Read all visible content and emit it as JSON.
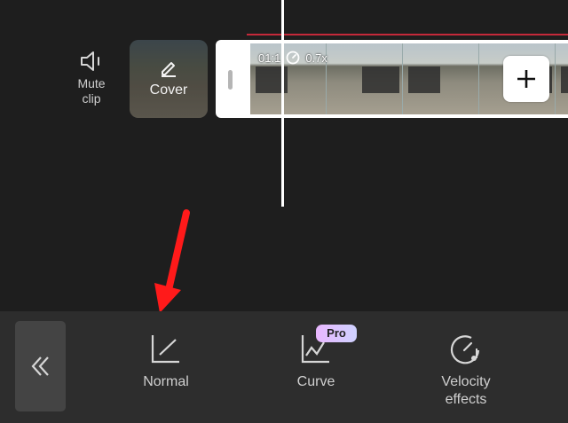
{
  "timeline": {
    "mute": {
      "label": "Mute\nclip",
      "icon": "speaker-icon"
    },
    "cover": {
      "label": "Cover",
      "icon": "pencil-icon"
    },
    "clip": {
      "duration": "01:1",
      "speed": "0.7x",
      "speed_icon": "speedometer-icon"
    },
    "add_icon": "plus-icon",
    "colors": {
      "marker_line": "#c4293a",
      "playhead": "#ffffff"
    }
  },
  "annotation": {
    "arrow_color": "#ff1a1a"
  },
  "toolbar": {
    "back_icon": "double-chevron-left-icon",
    "tools": [
      {
        "label": "Normal",
        "icon": "normal-speed-icon"
      },
      {
        "label": "Curve",
        "icon": "curve-speed-icon",
        "badge": "Pro"
      },
      {
        "label": "Velocity\neffects",
        "icon": "velocity-effects-icon"
      }
    ]
  }
}
